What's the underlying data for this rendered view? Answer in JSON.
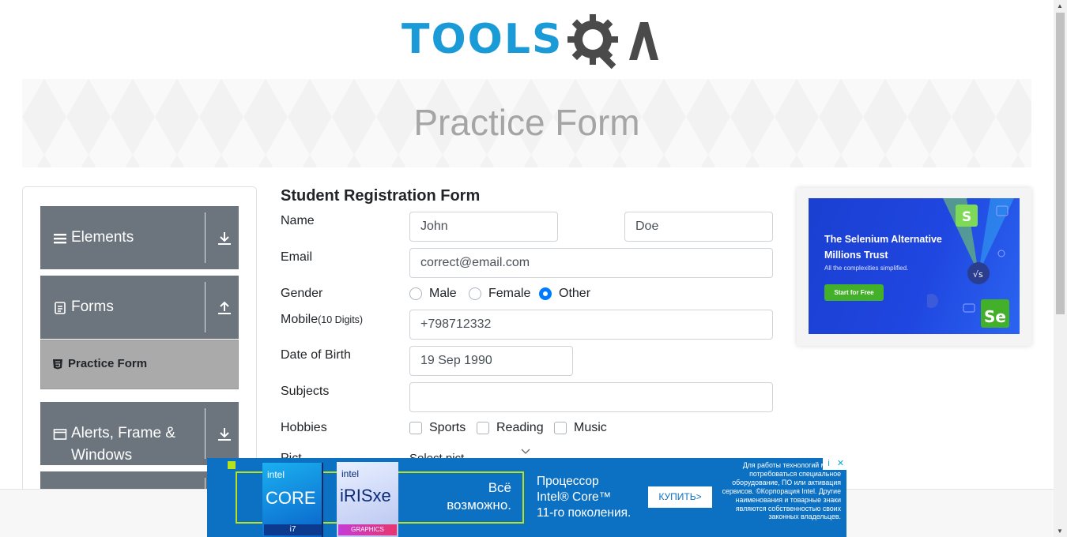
{
  "logo": {
    "text_tools": "TOOLS",
    "text_qa": "QA"
  },
  "banner": {
    "title": "Practice Form"
  },
  "sidebar": {
    "groups": [
      {
        "label": "Elements",
        "icon": "menu-icon",
        "toggle": "download-icon"
      },
      {
        "label": "Forms",
        "icon": "document-icon",
        "toggle": "upload-icon"
      },
      {
        "label_line1": "Alerts, Frame &",
        "label_line2": "Windows",
        "icon": "window-icon",
        "toggle": "download-icon"
      }
    ],
    "active_item": {
      "label": "Practice Form",
      "icon": "html5-icon"
    }
  },
  "form": {
    "title": "Student Registration Form",
    "name_label": "Name",
    "first_name": "John",
    "last_name": "Doe",
    "email_label": "Email",
    "email": "correct@email.com",
    "gender_label": "Gender",
    "gender_options": [
      "Male",
      "Female",
      "Other"
    ],
    "gender_selected": "Other",
    "mobile_label": "Mobile",
    "mobile_hint": "(10 Digits)",
    "mobile": "+798712332",
    "dob_label": "Date of Birth",
    "dob": "19 Sep 1990",
    "subjects_label": "Subjects",
    "subjects": "",
    "hobbies_label": "Hobbies",
    "hobbies_options": [
      "Sports",
      "Reading",
      "Music"
    ],
    "picture_label_partial": "Pict",
    "picture_select_partial": "Select pict"
  },
  "side_ad": {
    "headline_line1": "The Selenium Alternative",
    "headline_line2": "Millions Trust",
    "subtext": "All the complexities simplified.",
    "button": "Start for Free"
  },
  "bottom_ad": {
    "badge1_brand": "intel",
    "badge1_product": "CORE",
    "badge1_tier": "i7",
    "badge2_brand": "intel",
    "badge2_product": "iRISxe",
    "badge2_tag": "GRAPHICS",
    "slogan_line1": "Всё",
    "slogan_line2": "возможно.",
    "cpu_line1": "Процессор",
    "cpu_line2": "Intel® Core™",
    "cpu_line3": "11-го поколения.",
    "buy_button": "КУПИТЬ>",
    "fine_print": "Для работы технологий может потребоваться специальное оборудование, ПО или активация сервисов. ©Корпорация Intel. Другие наименования и товарные знаки являются собственностью своих законных владельцев.",
    "info_icon": "i",
    "close_icon": "✕"
  },
  "colors": {
    "brand_blue": "#1a9bd7",
    "sidebar_gray": "#6c757d",
    "active_gray": "#aaaaaa",
    "radio_blue": "#007bff"
  }
}
